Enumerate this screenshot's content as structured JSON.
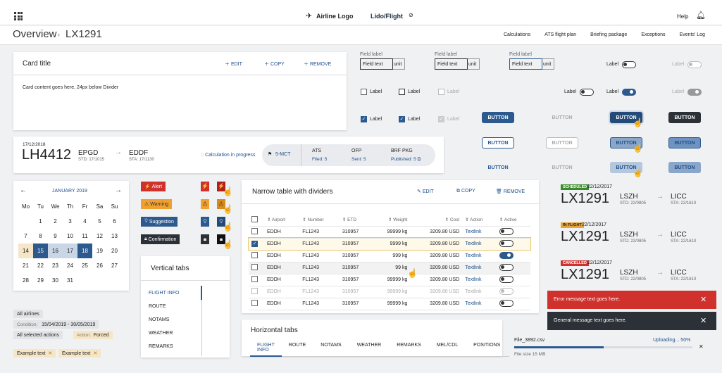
{
  "header": {
    "brand": "Airline Logo",
    "product": "Lido/Flight",
    "help": "Help"
  },
  "breadcrumb": {
    "root": "Overview",
    "current": "LX1291"
  },
  "subnav": [
    "Calculations",
    "ATS flight plan",
    "Briefing package",
    "Exceptions",
    "Events' Log"
  ],
  "card": {
    "title": "Card title",
    "edit": "EDIT",
    "copy": "COPY",
    "remove": "REMOVE",
    "content": "Card content goes here, 24px below Divider"
  },
  "fields": {
    "label": "Field label",
    "value": "Field text",
    "unit": "unit"
  },
  "controls": {
    "label": "Label"
  },
  "buttons": {
    "label": "BUTTON"
  },
  "flight": {
    "date": "17/12/2018",
    "number": "LH4412",
    "from": "EPGD",
    "std": "STD: 17/1015",
    "to": "EDDF",
    "sta": "STA: 17/1130",
    "calc": "Calculation in progress",
    "mct": "5-MCT",
    "ats": "ATS",
    "ats_sub": "Filed: 5",
    "ofp": "OFP",
    "ofp_sub": "Sent: 5",
    "brf": "BRF PKG",
    "brf_sub": "Published: 5"
  },
  "calendar": {
    "month": "JANUARY 2019",
    "days": [
      "Mo",
      "Tu",
      "We",
      "Th",
      "Fr",
      "Sa",
      "Su"
    ],
    "rows": [
      [
        "",
        "1",
        "2",
        "3",
        "4",
        "5",
        "6"
      ],
      [
        "7",
        "8",
        "9",
        "10",
        "11",
        "12",
        "13"
      ],
      [
        "14",
        "15",
        "16",
        "17",
        "18",
        "19",
        "20"
      ],
      [
        "21",
        "22",
        "23",
        "24",
        "25",
        "26",
        "27"
      ],
      [
        "28",
        "29",
        "30",
        "31",
        "",
        "",
        ""
      ]
    ]
  },
  "badges": {
    "alert": "Alert",
    "warning": "Warning",
    "suggestion": "Suggestion",
    "confirmation": "Confirmation"
  },
  "vtabs": {
    "title": "Vertical tabs",
    "items": [
      "FLIGHT INFO",
      "ROUTE",
      "NOTAMS",
      "WEATHER",
      "REMARKS"
    ]
  },
  "table": {
    "title": "Narrow table with dividers",
    "edit": "EDIT",
    "copy": "COPY",
    "remove": "REMOVE",
    "headers": [
      "Airport",
      "Number",
      "ETD",
      "Weight",
      "Cost",
      "Action",
      "Active"
    ],
    "rows": [
      [
        "EDDH",
        "FL1243",
        "310957",
        "99999 kg",
        "3209.80 USD",
        "Textlink"
      ],
      [
        "EDDH",
        "FL1243",
        "310957",
        "9999 kg",
        "3209.80 USD",
        "Textlink"
      ],
      [
        "EDDH",
        "FL1243",
        "310957",
        "999 kg",
        "3209.80 USD",
        "Textlink"
      ],
      [
        "EDDH",
        "FL1243",
        "310957",
        "99 kg",
        "3209.80 USD",
        "Textlink"
      ],
      [
        "EDDH",
        "FL1243",
        "310957",
        "99999 kg",
        "3209.80 USD",
        "Textlink"
      ],
      [
        "EDDH",
        "FL1243",
        "310957",
        "99999 kg",
        "3209.80 USD",
        "Textlink"
      ],
      [
        "EDDH",
        "FL1243",
        "310957",
        "99999 kg",
        "3209.80 USD",
        "Textlink"
      ]
    ]
  },
  "htabs": {
    "title": "Horizontal tabs",
    "items": [
      "FLIGHT INFO",
      "ROUTE",
      "NOTAMS",
      "WEATHER",
      "REMARKS",
      "MEL/CDL",
      "POSITIONS"
    ]
  },
  "filters": {
    "all_airlines": "All airlines",
    "condition_lbl": "Condition:",
    "condition": "15/04/2019 - 30/05/2019",
    "actions": "All selected actions",
    "action_lbl": "Action:",
    "action": "Forced",
    "chip": "Example text"
  },
  "flights": [
    {
      "status": "SCHEDULED",
      "date": "22/12/2017",
      "number": "LX1291",
      "from": "LSZH",
      "std": "STD: 22/0805",
      "to": "LICC",
      "sta": "STA: 22/1610",
      "color": "#3a8a2c"
    },
    {
      "status": "IN FLIGHT",
      "date": "22/12/2017",
      "number": "LX1291",
      "from": "LSZH",
      "std": "STD: 22/0805",
      "to": "LICC",
      "sta": "STA: 22/1610",
      "color": "#e8a33a"
    },
    {
      "status": "CANCELLED",
      "date": "22/12/2017",
      "number": "LX1291",
      "from": "LSZH",
      "std": "STD: 22/0805",
      "to": "LICC",
      "sta": "STA: 22/1610",
      "color": "#d0312d"
    }
  ],
  "messages": {
    "error": "Error message text goes here.",
    "general": "General message text goes here."
  },
  "upload": {
    "file": "File_3892.csv",
    "status": "Uploading... 50%",
    "size": "File size 15 MB",
    "progress": 0.5
  }
}
